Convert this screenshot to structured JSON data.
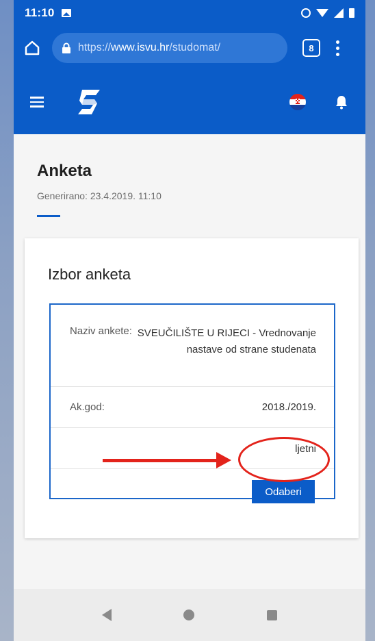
{
  "status_bar": {
    "time": "11:10"
  },
  "browser": {
    "url_scheme": "https://",
    "url_host": "www.isvu.hr",
    "url_path": "/studomat/",
    "tab_count": "8"
  },
  "page": {
    "title": "Anketa",
    "generated": "Generirano: 23.4.2019. 11:10"
  },
  "card": {
    "title": "Izbor anketa",
    "rows": [
      {
        "label": "Naziv ankete:",
        "value": "SVEUČILIŠTE U RIJECI - Vrednovanje nastave od strane studenata"
      },
      {
        "label": "Ak.god:",
        "value": "2018./2019."
      },
      {
        "label": "",
        "value": "ljetni"
      }
    ],
    "select_label": "Odaberi"
  },
  "colors": {
    "primary": "#0b5cc8",
    "annotation": "#e3231b"
  },
  "icons": {
    "home": "home-icon",
    "lock": "lock-icon",
    "menu": "hamburger-icon",
    "logo": "isvu-logo-icon",
    "flag": "croatian-flag-icon",
    "notifications": "bell-icon"
  }
}
